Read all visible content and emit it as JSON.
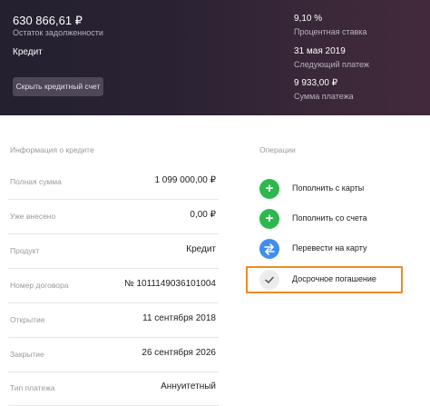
{
  "header": {
    "balance": "630 866,61 ₽",
    "balance_label": "Остаток задолженности",
    "product_name": "Кредит",
    "hide_button_label": "Скрыть кредитный счет",
    "rate": "9,10 %",
    "rate_label": "Процентная ставка",
    "next_payment_date": "31 мая 2019",
    "next_payment_label": "Следующий платеж",
    "payment_amount": "9 933,00 ₽",
    "payment_amount_label": "Сумма платежа"
  },
  "info": {
    "title": "Информация о кредите",
    "rows": [
      {
        "label": "Полная сумма",
        "value": "1 099 000,00 ₽"
      },
      {
        "label": "Уже внесено",
        "value": "0,00 ₽"
      },
      {
        "label": "Продукт",
        "value": "Кредит"
      },
      {
        "label": "Номер договора",
        "value": "№ 1011149036101004"
      },
      {
        "label": "Открытие",
        "value": "11 сентября 2018"
      },
      {
        "label": "Закрытие",
        "value": "26 сентября 2026"
      },
      {
        "label": "Тип платежа",
        "value": "Аннуитетный"
      }
    ]
  },
  "operations": {
    "title": "Операции",
    "items": [
      {
        "label": "Пополнить с карты",
        "icon": "plus-icon",
        "color": "#2db84d"
      },
      {
        "label": "Пополнить со счета",
        "icon": "plus-icon",
        "color": "#2db84d"
      },
      {
        "label": "Перевести на карту",
        "icon": "transfer-icon",
        "color": "#3f8ef0"
      },
      {
        "label": "Досрочное погашение",
        "icon": "check-icon",
        "color": "#ececec"
      }
    ]
  },
  "colors": {
    "highlight": "#f08a24",
    "green": "#2db84d",
    "blue": "#3f8ef0"
  }
}
